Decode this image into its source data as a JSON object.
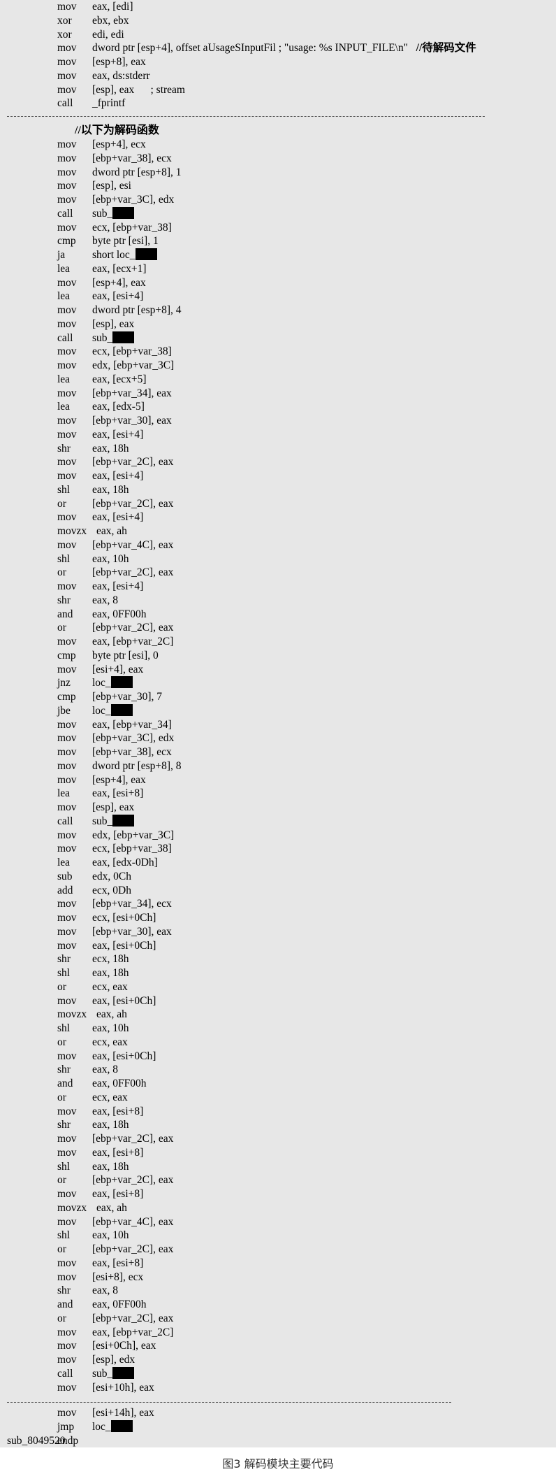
{
  "caption": "图3  解码模块主要代码",
  "top_lines": [
    {
      "mn": "mov",
      "op": "eax, [edi]"
    },
    {
      "mn": "xor",
      "op": "ebx, ebx"
    },
    {
      "mn": "xor",
      "op": "edi, edi"
    },
    {
      "mn": "mov",
      "op": "dword ptr [esp+4], offset aUsageSInputFil ; \"usage: %s INPUT_FILE\\n\"   ",
      "cm": "//待解码文件"
    },
    {
      "mn": "mov",
      "op": "[esp+8], eax"
    },
    {
      "mn": "mov",
      "op": "eax, ds:stderr"
    },
    {
      "mn": "mov",
      "op": "[esp], eax      ; stream"
    },
    {
      "mn": "call",
      "op": "_fprintf"
    }
  ],
  "decode_comment": "//以下为解码函数",
  "decode_lines": [
    {
      "mn": "mov",
      "op": "[esp+4], ecx"
    },
    {
      "mn": "mov",
      "op": "[ebp+var_38], ecx"
    },
    {
      "mn": "mov",
      "op": "dword ptr [esp+8], 1"
    },
    {
      "mn": "mov",
      "op": "[esp], esi"
    },
    {
      "mn": "mov",
      "op": "[ebp+var_3C], edx"
    },
    {
      "mn": "call",
      "op": "sub_",
      "redacted": true
    },
    {
      "mn": "mov",
      "op": "ecx, [ebp+var_38]"
    },
    {
      "mn": "cmp",
      "op": "byte ptr [esi], 1"
    },
    {
      "mn": "ja",
      "op": "short loc_",
      "redacted": true
    },
    {
      "mn": "lea",
      "op": "eax, [ecx+1]"
    },
    {
      "mn": "mov",
      "op": "[esp+4], eax"
    },
    {
      "mn": "lea",
      "op": "eax, [esi+4]"
    },
    {
      "mn": "mov",
      "op": "dword ptr [esp+8], 4"
    },
    {
      "mn": "mov",
      "op": "[esp], eax"
    },
    {
      "mn": "call",
      "op": "sub_",
      "redacted": true
    },
    {
      "mn": "mov",
      "op": "ecx, [ebp+var_38]"
    },
    {
      "mn": "mov",
      "op": "edx, [ebp+var_3C]"
    },
    {
      "mn": "lea",
      "op": "eax, [ecx+5]"
    },
    {
      "mn": "mov",
      "op": "[ebp+var_34], eax"
    },
    {
      "mn": "lea",
      "op": "eax, [edx-5]"
    },
    {
      "mn": "mov",
      "op": "[ebp+var_30], eax"
    },
    {
      "mn": "mov",
      "op": "eax, [esi+4]"
    },
    {
      "mn": "shr",
      "op": "eax, 18h"
    },
    {
      "mn": "mov",
      "op": "[ebp+var_2C], eax"
    },
    {
      "mn": "mov",
      "op": "eax, [esi+4]"
    },
    {
      "mn": "shl",
      "op": "eax, 18h"
    },
    {
      "mn": "or",
      "op": "[ebp+var_2C], eax"
    },
    {
      "mn": "mov",
      "op": "eax, [esi+4]"
    },
    {
      "mn": "movzx",
      "op": "eax, ah",
      "wide": true
    },
    {
      "mn": "mov",
      "op": "[ebp+var_4C], eax"
    },
    {
      "mn": "shl",
      "op": "eax, 10h"
    },
    {
      "mn": "or",
      "op": "[ebp+var_2C], eax"
    },
    {
      "mn": "mov",
      "op": "eax, [esi+4]"
    },
    {
      "mn": "shr",
      "op": "eax, 8"
    },
    {
      "mn": "and",
      "op": "eax, 0FF00h"
    },
    {
      "mn": "or",
      "op": "[ebp+var_2C], eax"
    },
    {
      "mn": "mov",
      "op": "eax, [ebp+var_2C]"
    },
    {
      "mn": "cmp",
      "op": "byte ptr [esi], 0"
    },
    {
      "mn": "mov",
      "op": "[esi+4], eax"
    },
    {
      "mn": "jnz",
      "op": "loc_",
      "redacted": true
    },
    {
      "mn": "cmp",
      "op": "[ebp+var_30], 7"
    },
    {
      "mn": "jbe",
      "op": "loc_",
      "redacted": true
    },
    {
      "mn": "mov",
      "op": "eax, [ebp+var_34]"
    },
    {
      "mn": "mov",
      "op": "[ebp+var_3C], edx"
    },
    {
      "mn": "mov",
      "op": "[ebp+var_38], ecx"
    },
    {
      "mn": "mov",
      "op": "dword ptr [esp+8], 8"
    },
    {
      "mn": "mov",
      "op": "[esp+4], eax"
    },
    {
      "mn": "lea",
      "op": "eax, [esi+8]"
    },
    {
      "mn": "mov",
      "op": "[esp], eax"
    },
    {
      "mn": "call",
      "op": "sub_",
      "redacted": true
    },
    {
      "mn": "mov",
      "op": "edx, [ebp+var_3C]"
    },
    {
      "mn": "mov",
      "op": "ecx, [ebp+var_38]"
    },
    {
      "mn": "lea",
      "op": "eax, [edx-0Dh]"
    },
    {
      "mn": "sub",
      "op": "edx, 0Ch"
    },
    {
      "mn": "add",
      "op": "ecx, 0Dh"
    },
    {
      "mn": "mov",
      "op": "[ebp+var_34], ecx"
    },
    {
      "mn": "mov",
      "op": "ecx, [esi+0Ch]"
    },
    {
      "mn": "mov",
      "op": "[ebp+var_30], eax"
    },
    {
      "mn": "mov",
      "op": "eax, [esi+0Ch]"
    },
    {
      "mn": "shr",
      "op": "ecx, 18h"
    },
    {
      "mn": "shl",
      "op": "eax, 18h"
    },
    {
      "mn": "or",
      "op": "ecx, eax"
    },
    {
      "mn": "mov",
      "op": "eax, [esi+0Ch]"
    },
    {
      "mn": "movzx",
      "op": "eax, ah",
      "wide": true
    },
    {
      "mn": "shl",
      "op": "eax, 10h"
    },
    {
      "mn": "or",
      "op": "ecx, eax"
    },
    {
      "mn": "mov",
      "op": "eax, [esi+0Ch]"
    },
    {
      "mn": "shr",
      "op": "eax, 8"
    },
    {
      "mn": "and",
      "op": "eax, 0FF00h"
    },
    {
      "mn": "or",
      "op": "ecx, eax"
    },
    {
      "mn": "mov",
      "op": "eax, [esi+8]"
    },
    {
      "mn": "shr",
      "op": "eax, 18h"
    },
    {
      "mn": "mov",
      "op": "[ebp+var_2C], eax"
    },
    {
      "mn": "mov",
      "op": "eax, [esi+8]"
    },
    {
      "mn": "shl",
      "op": "eax, 18h"
    },
    {
      "mn": "or",
      "op": "[ebp+var_2C], eax"
    },
    {
      "mn": "mov",
      "op": "eax, [esi+8]"
    },
    {
      "mn": "movzx",
      "op": "eax, ah",
      "wide": true
    },
    {
      "mn": "mov",
      "op": "[ebp+var_4C], eax"
    },
    {
      "mn": "shl",
      "op": "eax, 10h"
    },
    {
      "mn": "or",
      "op": "[ebp+var_2C], eax"
    },
    {
      "mn": "mov",
      "op": "eax, [esi+8]"
    },
    {
      "mn": "mov",
      "op": "[esi+8], ecx"
    },
    {
      "mn": "shr",
      "op": "eax, 8"
    },
    {
      "mn": "and",
      "op": "eax, 0FF00h"
    },
    {
      "mn": "or",
      "op": "[ebp+var_2C], eax"
    },
    {
      "mn": "mov",
      "op": "eax, [ebp+var_2C]"
    },
    {
      "mn": "mov",
      "op": "[esi+0Ch], eax"
    },
    {
      "mn": "mov",
      "op": "[esp], edx"
    },
    {
      "mn": "call",
      "op": "sub_",
      "redacted": true
    },
    {
      "mn": "mov",
      "op": "[esi+10h], eax"
    }
  ],
  "tail_lines": [
    {
      "mn": "mov",
      "op": "[esi+14h], eax"
    },
    {
      "mn": "jmp",
      "op": "loc_",
      "redacted": true
    },
    {
      "label": "sub_8049520",
      "mn": "endp",
      "op": ""
    }
  ]
}
